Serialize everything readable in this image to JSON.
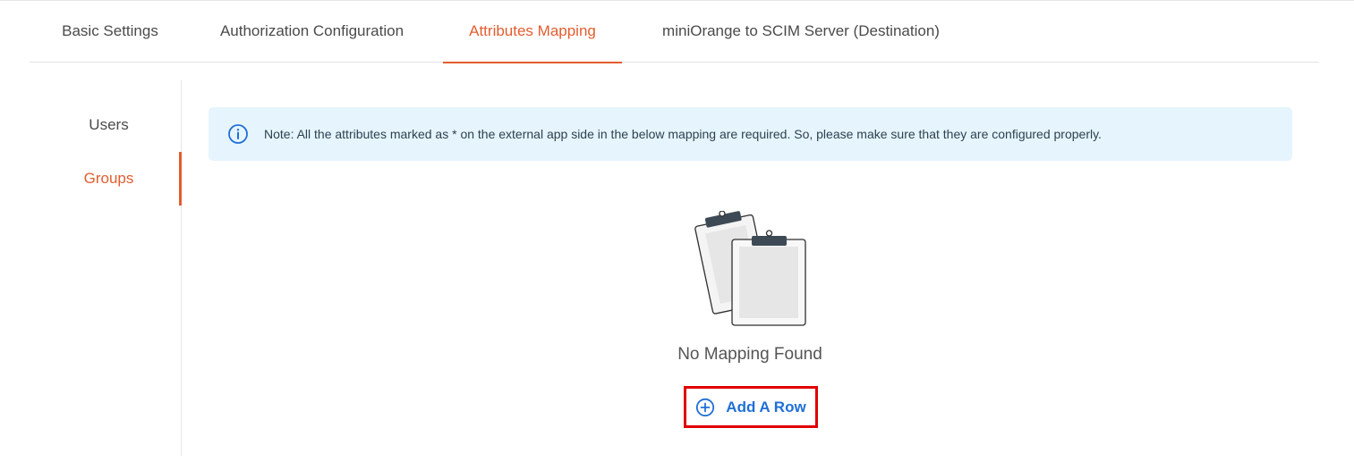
{
  "tabs": [
    {
      "label": "Basic Settings",
      "active": false
    },
    {
      "label": "Authorization Configuration",
      "active": false
    },
    {
      "label": "Attributes Mapping",
      "active": true
    },
    {
      "label": "miniOrange to SCIM Server (Destination)",
      "active": false
    }
  ],
  "sidebar": {
    "items": [
      {
        "label": "Users",
        "active": false
      },
      {
        "label": "Groups",
        "active": true
      }
    ]
  },
  "note": {
    "icon": "info-icon",
    "text": "Note: All the attributes marked as * on the external app side in the below mapping are required. So, please make sure that they are configured properly."
  },
  "empty_state": {
    "icon": "clipboards-illustration",
    "message": "No Mapping Found",
    "add_label": "Add A Row",
    "add_icon": "plus-circle-icon"
  },
  "colors": {
    "accent": "#e35d2f",
    "link": "#1f6fd6",
    "note_bg": "#e6f5fd",
    "highlight": "#e00000"
  }
}
